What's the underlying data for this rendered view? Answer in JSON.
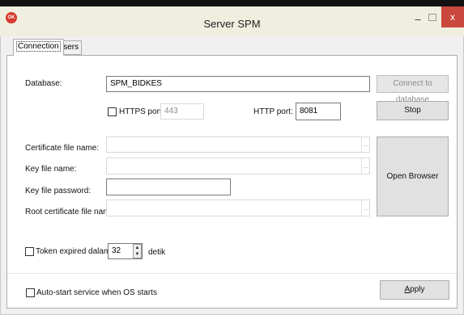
{
  "window": {
    "title": "Server SPM",
    "app_icon_text": "OK",
    "minimize_glyph": "–",
    "close_glyph": "x",
    "close_color": "#c9473d"
  },
  "tabs": [
    {
      "label": "Connection",
      "active": true
    },
    {
      "label": "Users",
      "active": false
    }
  ],
  "connection": {
    "database_label": "Database:",
    "database_value": "SPM_BIDKES",
    "connect_button": "Connect to database",
    "https_label": "HTTPS port:",
    "https_checked": false,
    "https_port": "443",
    "http_label": "HTTP port:",
    "http_port": "8081",
    "stop_button": "Stop",
    "cert_file_label": "Certificate file name:",
    "cert_file_value": "",
    "key_file_label": "Key file name:",
    "key_file_value": "",
    "key_password_label": "Key file password:",
    "key_password_value": "",
    "root_cert_label": "Root certificate file name:",
    "root_cert_value": "",
    "browse_glyph": "...",
    "open_browser_button": "Open Browser",
    "token_label": "Token expired dalam",
    "token_checked": false,
    "token_value": "32",
    "token_unit": "detik",
    "autostart_label": "Auto-start service when OS starts",
    "autostart_checked": false,
    "apply_prefix": "A",
    "apply_rest": "pply"
  }
}
